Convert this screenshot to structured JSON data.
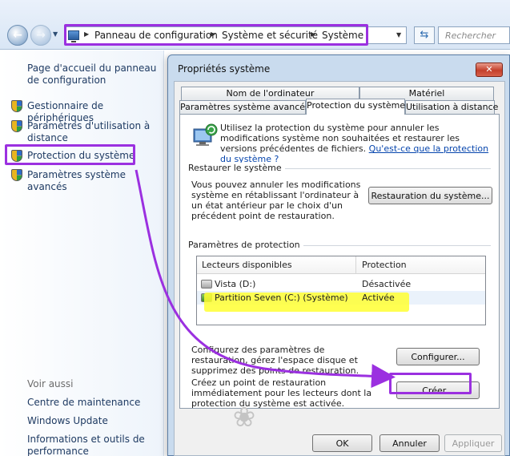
{
  "address_bar": {
    "breadcrumbs": [
      "Panneau de configuration",
      "Système et sécurité",
      "Système"
    ],
    "search_placeholder": "Rechercher"
  },
  "left_pane": {
    "home_link": "Page d'accueil du panneau de configuration",
    "tasks": [
      "Gestionnaire de périphériques",
      "Paramètres d'utilisation à distance",
      "Protection du système",
      "Paramètres système avancés"
    ],
    "see_also_title": "Voir aussi",
    "see_also": [
      "Centre de maintenance",
      "Windows Update",
      "Informations et outils de performance"
    ]
  },
  "dialog": {
    "title": "Propriétés système",
    "close_glyph": "✕",
    "tabs_back": [
      "Nom de l'ordinateur",
      "Matériel"
    ],
    "tabs_front": [
      "Paramètres système avancés",
      "Protection du système",
      "Utilisation à distance"
    ],
    "active_tab": "Protection du système",
    "intro_text": "Utilisez la protection du système pour annuler les modifications système non souhaitées et restaurer les versions précédentes de fichiers.",
    "intro_link": "Qu'est-ce que la protection du système ?",
    "restore": {
      "group_label": "Restaurer le système",
      "description": "Vous pouvez annuler les modifications système en rétablissant l'ordinateur à un état antérieur par le choix d'un précédent point de restauration.",
      "button": "Restauration du système..."
    },
    "protection": {
      "group_label": "Paramètres de protection",
      "columns": [
        "Lecteurs disponibles",
        "Protection"
      ],
      "drives": [
        {
          "name": "Vista (D:)",
          "protection": "Désactivée"
        },
        {
          "name": "Partition Seven (C:) (Système)",
          "protection": "Activée"
        }
      ],
      "configure_text": "Configurez des paramètres de restauration, gérez l'espace disque et supprimez des points de restauration.",
      "configure_button": "Configurer...",
      "create_text": "Créez un point de restauration immédiatement pour les lecteurs dont la protection du système est activée.",
      "create_button": "Créer..."
    },
    "footer_buttons": {
      "ok": "OK",
      "cancel": "Annuler",
      "apply": "Appliquer"
    }
  },
  "annotations": {
    "highlight_color": "#9b30e0",
    "marker_color": "#ffff33"
  }
}
